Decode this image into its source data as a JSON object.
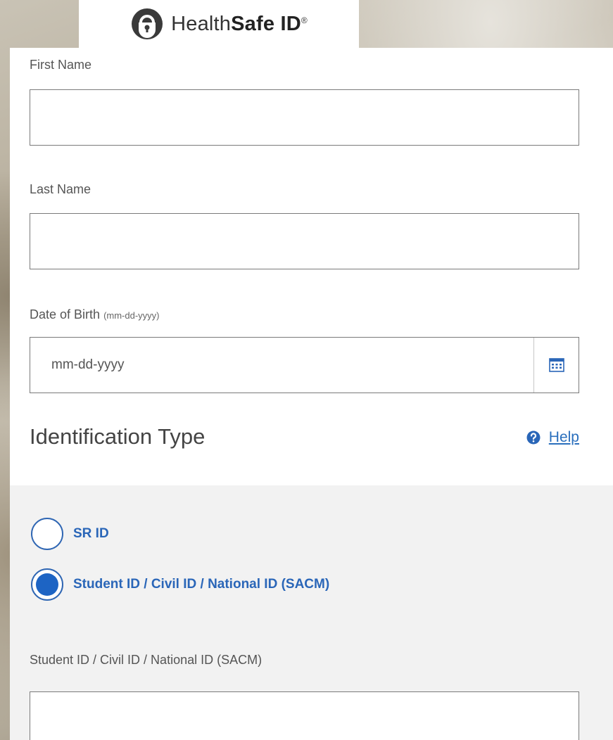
{
  "logo": {
    "brand_regular": "Health",
    "brand_bold": "Safe ID",
    "brand_mark": "®"
  },
  "form": {
    "first_name_label": "First Name",
    "first_name_value": "",
    "last_name_label": "Last Name",
    "last_name_value": "",
    "dob_label": "Date of Birth",
    "dob_hint": "(mm-dd-yyyy)",
    "dob_placeholder": "mm-dd-yyyy",
    "id_type_title": "Identification Type",
    "help_label": "Help",
    "radio_options": [
      {
        "label": "SR ID",
        "selected": false
      },
      {
        "label": "Student ID / Civil ID / National ID (SACM)",
        "selected": true
      }
    ],
    "id_field_label": "Student ID / Civil ID / National ID (SACM)",
    "id_field_value": ""
  },
  "colors": {
    "accent": "#2a66b8",
    "radio_fill": "#1d64c4",
    "section_bg": "#f2f2f2"
  },
  "icons": [
    "healthsafe-lock-icon",
    "calendar-icon",
    "help-circle-icon"
  ]
}
